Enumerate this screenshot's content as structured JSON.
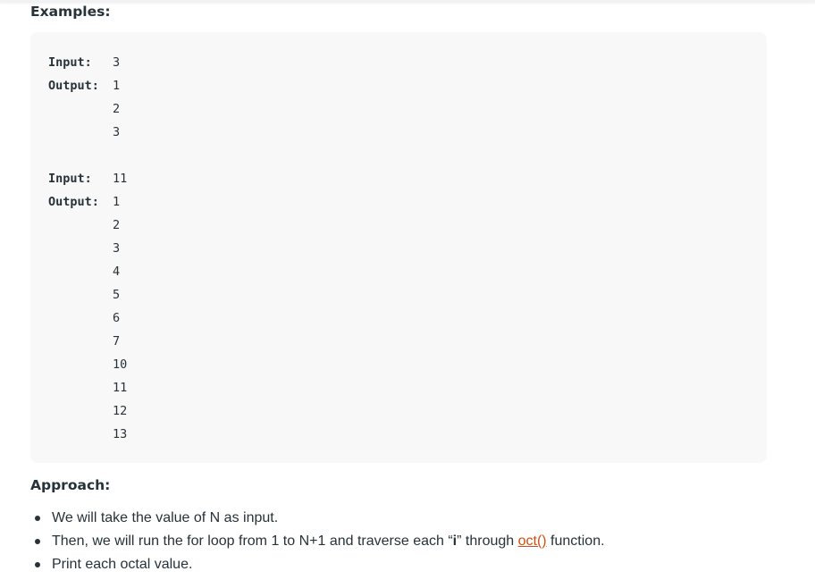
{
  "examples": {
    "heading": "Examples:",
    "example1": {
      "input_label": "Input:",
      "input_value": "3",
      "output_label": "Output:",
      "output_values": [
        "1",
        "2",
        "3"
      ]
    },
    "example2": {
      "input_label": "Input:",
      "input_value": "11",
      "output_label": "Output:",
      "output_values": [
        "1",
        "2",
        "3",
        "4",
        "5",
        "6",
        "7",
        "10",
        "11",
        "12",
        "13"
      ]
    }
  },
  "approach": {
    "heading": "Approach:",
    "bullet1": "We will take the value of N as input.",
    "bullet2": {
      "before": "Then, we will run the for loop from 1 to N+1 and traverse each “",
      "bold": "i",
      "middle": "” through ",
      "link": "oct()",
      "after": " function."
    },
    "bullet3": "Print each octal value."
  },
  "colors": {
    "text": "#273239",
    "link": "#d14f14",
    "code_bg": "#f8f8f8"
  }
}
